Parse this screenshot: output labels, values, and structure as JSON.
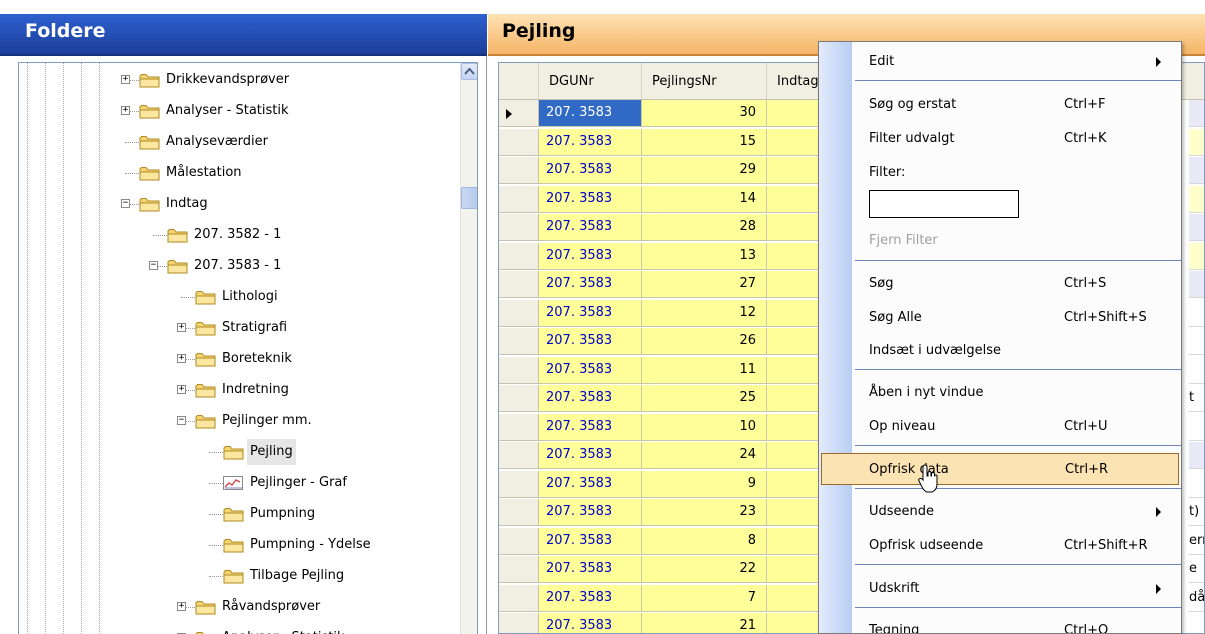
{
  "left_panel": {
    "title": "Foldere",
    "tree": [
      {
        "label": "Drikkevandsprøver",
        "level": 0,
        "expander": "+",
        "icon": "folder-icon"
      },
      {
        "label": "Analyser - Statistik",
        "level": 0,
        "expander": "+",
        "icon": "folder-icon"
      },
      {
        "label": "Analyseværdier",
        "level": 0,
        "expander": "",
        "icon": "folder-icon"
      },
      {
        "label": "Målestation",
        "level": 0,
        "expander": "",
        "icon": "folder-icon"
      },
      {
        "label": "Indtag",
        "level": 0,
        "expander": "−",
        "icon": "folder-icon"
      },
      {
        "label": "207. 3582 - 1",
        "level": 1,
        "expander": "",
        "icon": "folder-icon"
      },
      {
        "label": "207. 3583 - 1",
        "level": 1,
        "expander": "−",
        "icon": "folder-icon"
      },
      {
        "label": "Lithologi",
        "level": 2,
        "expander": "",
        "icon": "folder-icon"
      },
      {
        "label": "Stratigrafi",
        "level": 2,
        "expander": "+",
        "icon": "folder-icon"
      },
      {
        "label": "Boreteknik",
        "level": 2,
        "expander": "+",
        "icon": "folder-icon"
      },
      {
        "label": "Indretning",
        "level": 2,
        "expander": "+",
        "icon": "folder-icon"
      },
      {
        "label": "Pejlinger mm.",
        "level": 2,
        "expander": "−",
        "icon": "folder-icon"
      },
      {
        "label": "Pejling",
        "level": 3,
        "expander": "",
        "icon": "folder-icon",
        "selected": true
      },
      {
        "label": "Pejlinger - Graf",
        "level": 3,
        "expander": "",
        "icon": "graph-icon"
      },
      {
        "label": "Pumpning",
        "level": 3,
        "expander": "",
        "icon": "folder-icon"
      },
      {
        "label": "Pumpning - Ydelse",
        "level": 3,
        "expander": "",
        "icon": "folder-icon"
      },
      {
        "label": "Tilbage Pejling",
        "level": 3,
        "expander": "",
        "icon": "folder-icon"
      },
      {
        "label": "Råvandsprøver",
        "level": 2,
        "expander": "+",
        "icon": "folder-icon"
      },
      {
        "label": "Analyser - Statistik",
        "level": 2,
        "expander": "+",
        "icon": "folder-icon"
      }
    ]
  },
  "right_panel": {
    "title": "Pejling",
    "columns": [
      "DGUNr",
      "PejlingsNr",
      "Indtag"
    ],
    "rows": [
      {
        "dgunr": "207. 3583",
        "pejlingsnr": "30"
      },
      {
        "dgunr": "207. 3583",
        "pejlingsnr": "15"
      },
      {
        "dgunr": "207. 3583",
        "pejlingsnr": "29"
      },
      {
        "dgunr": "207. 3583",
        "pejlingsnr": "14"
      },
      {
        "dgunr": "207. 3583",
        "pejlingsnr": "28"
      },
      {
        "dgunr": "207. 3583",
        "pejlingsnr": "13"
      },
      {
        "dgunr": "207. 3583",
        "pejlingsnr": "27"
      },
      {
        "dgunr": "207. 3583",
        "pejlingsnr": "12"
      },
      {
        "dgunr": "207. 3583",
        "pejlingsnr": "26"
      },
      {
        "dgunr": "207. 3583",
        "pejlingsnr": "11"
      },
      {
        "dgunr": "207. 3583",
        "pejlingsnr": "25"
      },
      {
        "dgunr": "207. 3583",
        "pejlingsnr": "10"
      },
      {
        "dgunr": "207. 3583",
        "pejlingsnr": "24"
      },
      {
        "dgunr": "207. 3583",
        "pejlingsnr": "9"
      },
      {
        "dgunr": "207. 3583",
        "pejlingsnr": "23"
      },
      {
        "dgunr": "207. 3583",
        "pejlingsnr": "8"
      },
      {
        "dgunr": "207. 3583",
        "pejlingsnr": "22"
      },
      {
        "dgunr": "207. 3583",
        "pejlingsnr": "7"
      },
      {
        "dgunr": "207. 3583",
        "pejlingsnr": "21"
      }
    ],
    "edge_fragments": [
      "",
      "",
      "",
      "",
      "",
      "",
      "",
      "",
      "",
      "",
      "t",
      "",
      "",
      "",
      "t)",
      "err...",
      "e",
      "då...",
      ""
    ]
  },
  "context_menu": {
    "items": [
      {
        "label": "Edit",
        "shortcut": "",
        "submenu": true
      },
      {
        "label": "Søg og erstat",
        "shortcut": "Ctrl+F"
      },
      {
        "label": "Filter udvalgt",
        "shortcut": "Ctrl+K"
      },
      {
        "label": "Filter:",
        "shortcut": ""
      },
      {
        "label": "Fjern Filter",
        "shortcut": "",
        "disabled": true
      },
      {
        "label": "Søg",
        "shortcut": "Ctrl+S"
      },
      {
        "label": "Søg Alle",
        "shortcut": "Ctrl+Shift+S"
      },
      {
        "label": "Indsæt i udvælgelse",
        "shortcut": ""
      },
      {
        "label": "Åben i nyt vindue",
        "shortcut": ""
      },
      {
        "label": "Op niveau",
        "shortcut": "Ctrl+U"
      },
      {
        "label": "Opfrisk data",
        "shortcut": "Ctrl+R",
        "highlighted": true
      },
      {
        "label": "Udseende",
        "shortcut": "",
        "submenu": true
      },
      {
        "label": "Opfrisk udseende",
        "shortcut": "Ctrl+Shift+R"
      },
      {
        "label": "Udskrift",
        "shortcut": "",
        "submenu": true
      },
      {
        "label": "Tegning",
        "shortcut": "Ctrl+Q"
      }
    ],
    "filter_value": ""
  },
  "colors": {
    "left_header": "#2d5fcf",
    "right_header": "#f6b466",
    "cell_yellow": "#ffff99",
    "selection_blue": "#316ac5",
    "menu_highlight": "#fbe3b3"
  }
}
